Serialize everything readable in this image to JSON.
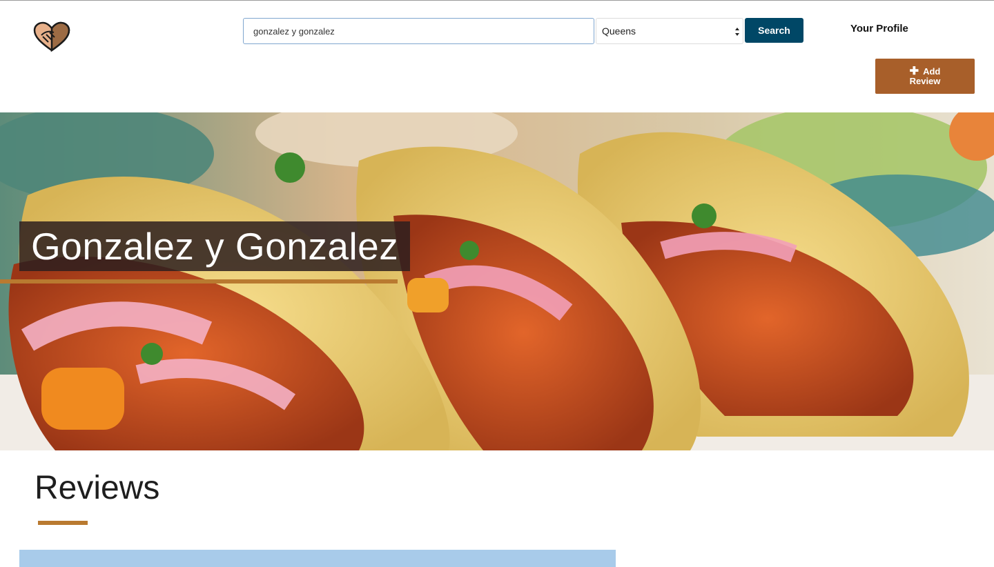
{
  "header": {
    "search": {
      "value": "gonzalez y gonzalez"
    },
    "borough": {
      "selected": "Queens"
    },
    "search_label": "Search",
    "profile_label": "Your Profile",
    "add_review": {
      "line1": "Add",
      "line2": "Review",
      "icon": "plus-icon"
    },
    "logo_icon": "handshake-icon"
  },
  "hero": {
    "title": "Gonzalez y Gonzalez",
    "image_subject": "tacos"
  },
  "reviews": {
    "heading": "Reviews"
  },
  "colors": {
    "search_button": "#004766",
    "add_review_button": "#a85f2a",
    "accent_underline": "#b97a30",
    "review_card": "#a8cbea"
  }
}
